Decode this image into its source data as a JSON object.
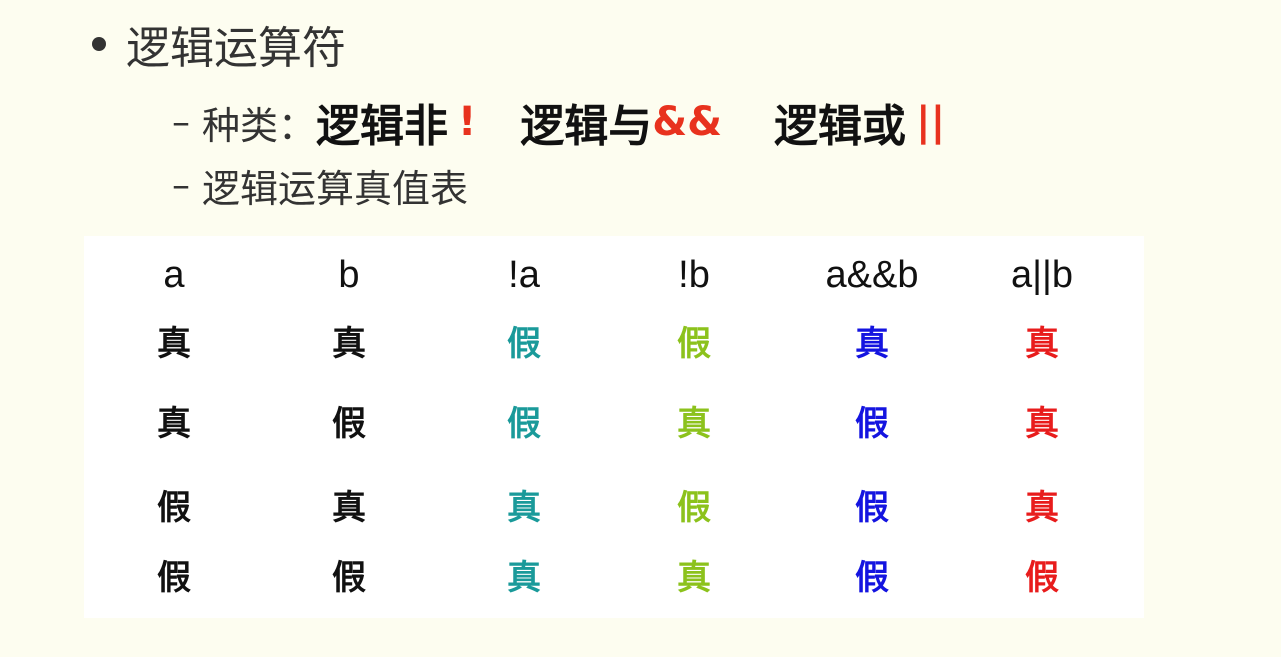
{
  "bullet": {
    "text": "逻辑运算符"
  },
  "kinds": {
    "dash": "–",
    "label": "种类：",
    "not_label": "逻辑非",
    "not_op": "!",
    "and_label": "逻辑与",
    "and_op": "&&",
    "or_label": "逻辑或",
    "or_op": "||"
  },
  "truth_table_heading": {
    "dash": "–",
    "text": "逻辑运算真值表"
  },
  "truth_table": {
    "headers": [
      "a",
      "b",
      "!a",
      "!b",
      "a&&b",
      "a||b"
    ],
    "column_colors": [
      "#111111",
      "#111111",
      "#1a9a9a",
      "#8cc21c",
      "#1414e0",
      "#e81c1c"
    ],
    "rows": [
      [
        "真",
        "真",
        "假",
        "假",
        "真",
        "真"
      ],
      [
        "真",
        "假",
        "假",
        "真",
        "假",
        "真"
      ],
      [
        "假",
        "真",
        "真",
        "假",
        "假",
        "真"
      ],
      [
        "假",
        "假",
        "真",
        "真",
        "假",
        "假"
      ]
    ]
  }
}
